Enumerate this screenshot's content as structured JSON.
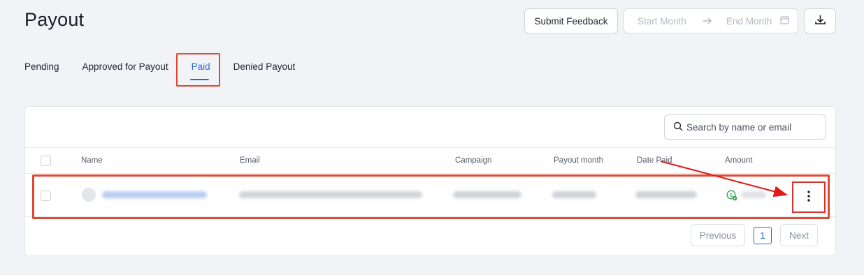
{
  "header": {
    "title": "Payout",
    "submit_feedback_label": "Submit Feedback",
    "date_range": {
      "start_placeholder": "Start Month",
      "end_placeholder": "End Month"
    }
  },
  "tabs": [
    {
      "label": "Pending"
    },
    {
      "label": "Approved for Payout"
    },
    {
      "label": "Paid",
      "active": true
    },
    {
      "label": "Denied Payout"
    }
  ],
  "search": {
    "placeholder": "Search by name or email"
  },
  "table": {
    "columns": [
      "Name",
      "Email",
      "Campaign",
      "Payout month",
      "Date Paid",
      "Amount"
    ]
  },
  "pagination": {
    "previous_label": "Previous",
    "current_page": "1",
    "next_label": "Next"
  },
  "colors": {
    "accent": "#2a6bd1",
    "annotation_red": "#e0492f",
    "paid_green": "#2e9e4a"
  },
  "icons": [
    "download-icon",
    "calendar-icon",
    "search-icon",
    "dollar-paid-icon",
    "kebab-menu-icon"
  ]
}
